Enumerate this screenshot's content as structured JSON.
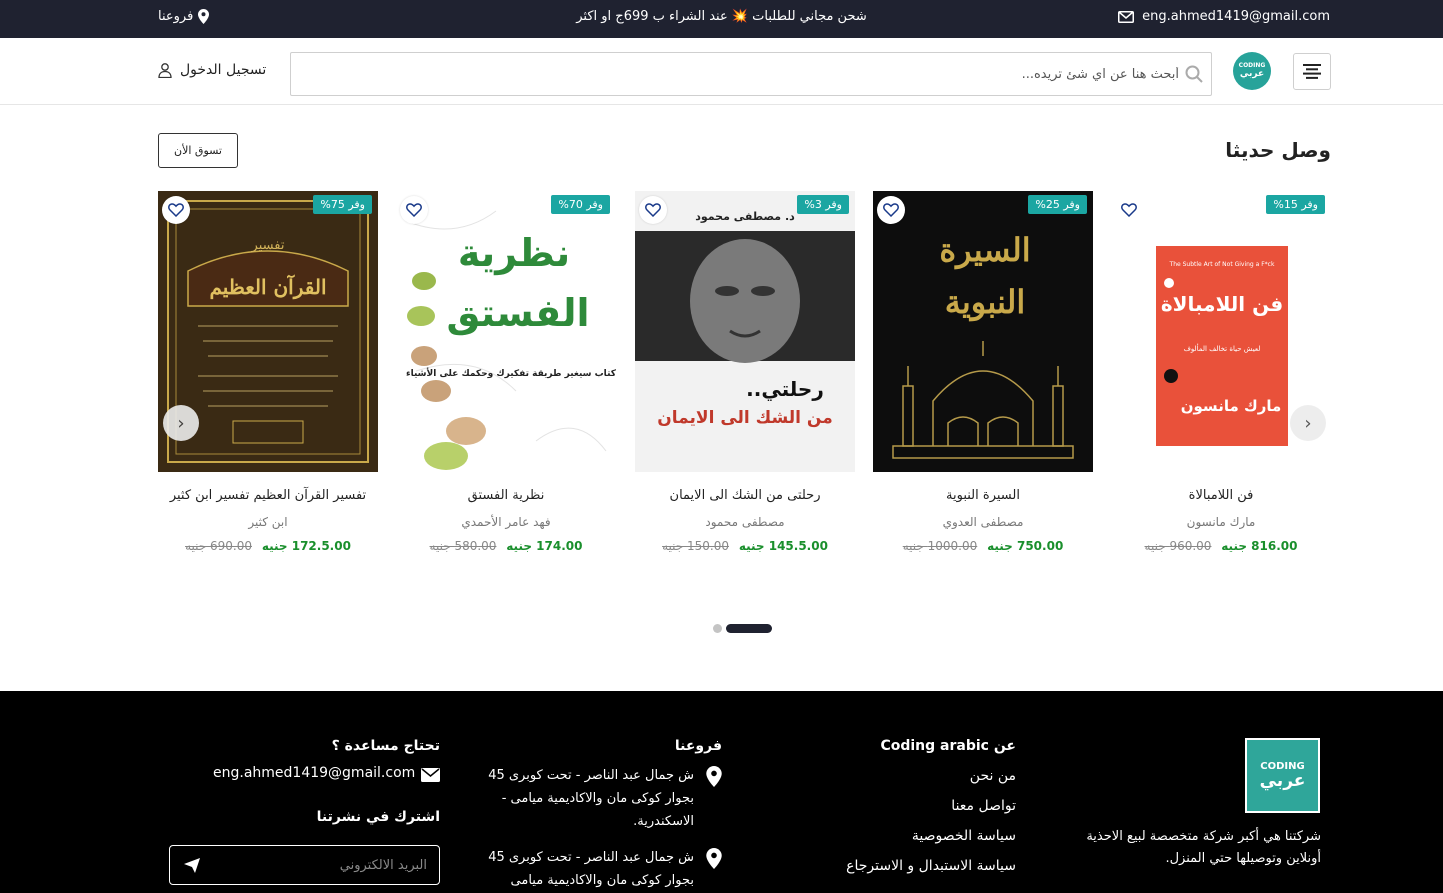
{
  "topbar": {
    "email": "eng.ahmed1419@gmail.com",
    "promo": "شحن مجاني للطلبات 💥 عند الشراء ب 699ج او اكثر",
    "branches": "فروعنا"
  },
  "header": {
    "logo_en": "CODING",
    "logo_ar": "عربي",
    "search_placeholder": "أبحث هنا عن اي شئ تريده...",
    "login": "تسجيل الدخول"
  },
  "section": {
    "title": "وصل حديثا",
    "shop_button": "تسوق الأن"
  },
  "products": [
    {
      "title": "فن اللامبالاة",
      "author": "مارك مانسون",
      "price": "816.00 جنيه",
      "old_price": "960.00 جنيه",
      "discount": "وفر 15%",
      "cover_color": "#e9513a"
    },
    {
      "title": "السيرة النبوية",
      "author": "مصطفى العدوي",
      "price": "750.00 جنيه",
      "old_price": "1000.00 جنيه",
      "discount": "وفر 25%",
      "cover_color": "#0d0d0d"
    },
    {
      "title": "رحلتى من الشك الى الايمان",
      "author": "مصطفى محمود",
      "price": "145.5.00 جنيه",
      "old_price": "150.00 جنيه",
      "discount": "وفر 3%",
      "cover_color": "#f2f2f2"
    },
    {
      "title": "نظرية الفستق",
      "author": "فهد عامر الأحمدي",
      "price": "174.00 جنيه",
      "old_price": "580.00 جنيه",
      "discount": "وفر 70%",
      "cover_color": "#ffffff"
    },
    {
      "title": "تفسير القرآن العظيم تفسير ابن كثير",
      "author": "ابن كثير",
      "price": "172.5.00 جنيه",
      "old_price": "690.00 جنيه",
      "discount": "وفر 75%",
      "cover_color": "#3a2a14"
    }
  ],
  "covers": {
    "book1_subtitle": "The Subtle Art of Not Giving a F*ck",
    "book1_title": "فن اللامبالاة",
    "book1_tagline": "لعيش حياة تخالف المألوف",
    "book1_author": "مارك مانسون",
    "book2_title_a": "السيرة",
    "book2_title_b": "النبوية",
    "book3_author": "د. مصطفى محمود",
    "book3_title_a": "رحلتي..",
    "book3_title_b": "من الشك الى الايمان",
    "book4_title_a": "نظرية",
    "book4_title_b": "الفستق",
    "book4_tagline": "كتاب سيغير طريقة تفكيرك وحكمك على الأشياء",
    "book5_title_a": "تفسير",
    "book5_title_b": "القرآن العظيم"
  },
  "footer": {
    "logo_en": "CODING",
    "logo_ar": "عربي",
    "about_text": "شركتنا هي أكبر شركة متخصصة لبيع الاحذية أونلاين وتوصيلها حتي المنزل.",
    "about_heading": "عن Coding arabic",
    "links": [
      "من نحن",
      "تواصل معنا",
      "سياسة الخصوصية",
      "سياسة الاستبدال و الاسترجاع"
    ],
    "branches_heading": "فروعنا",
    "branch_1": "ش جمال عبد الناصر - تحت كوبرى 45 بجوار كوكى مان والاكاديمية ميامى - الاسكندرية.",
    "branch_2": "ش جمال عبد الناصر - تحت كوبرى 45 بجوار كوكى مان والاكاديمية ميامى",
    "help_heading": "تحتاج مساعدة ؟",
    "help_email": "eng.ahmed1419@gmail.com",
    "newsletter_heading": "اشترك في نشرتنا",
    "newsletter_placeholder": "البريد الالكتروني"
  },
  "colors": {
    "topbar": "#1f2230",
    "accent": "#1ba6a2",
    "price": "#1a8f2c",
    "footer": "#000000"
  }
}
